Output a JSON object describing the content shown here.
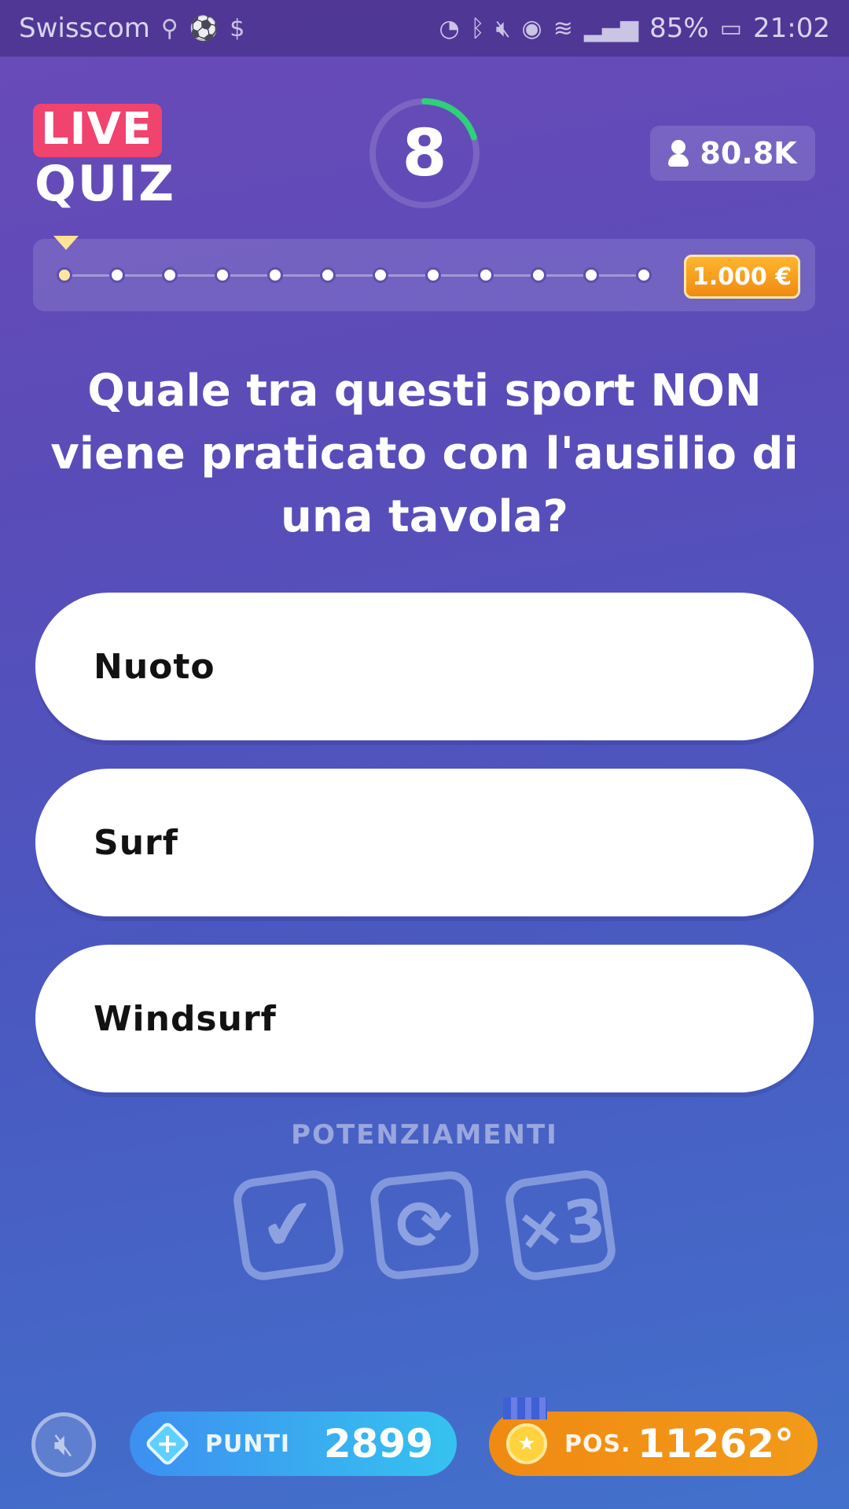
{
  "status_bar": {
    "carrier": "Swisscom",
    "left_icons": [
      "usb-icon",
      "soccer-icon",
      "dollar-icon"
    ],
    "right_icons": [
      "nfc-icon",
      "bluetooth-icon",
      "mute-icon",
      "eye-icon",
      "wifi-icon",
      "signal-icon"
    ],
    "battery": "85%",
    "time": "21:02"
  },
  "header": {
    "logo_live": "LIVE",
    "logo_quiz": "QUIZ",
    "timer_value": "8",
    "timer_fraction_remaining": 0.2,
    "viewers": "80.8K"
  },
  "progress": {
    "steps": 12,
    "current_step": 1,
    "prize": "1.000 €"
  },
  "question": "Quale tra questi sport NON viene praticato con l'ausilio di una tavola?",
  "answers": [
    {
      "label": "Nuoto"
    },
    {
      "label": "Surf"
    },
    {
      "label": "Windsurf"
    }
  ],
  "powerups": {
    "title": "POTENZIAMENTI",
    "items": [
      {
        "icon": "check-icon",
        "glyph": "✔"
      },
      {
        "icon": "refresh-icon",
        "glyph": "⟳"
      },
      {
        "icon": "times-three-icon",
        "glyph": "×3"
      }
    ]
  },
  "footer": {
    "points_label": "PUNTI",
    "points_value": "2899",
    "rank_label": "POS.",
    "rank_value": "11262°"
  },
  "colors": {
    "live_badge": "#f0436e",
    "timer_arc": "#2fd07a",
    "prize_badge": "#f5a11e",
    "points_pill": "#3d9cf2",
    "rank_pill": "#f08a12"
  }
}
